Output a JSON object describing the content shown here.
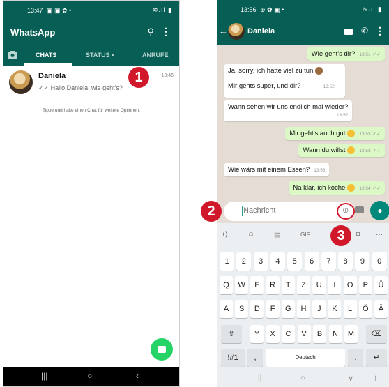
{
  "left_phone": {
    "status_time": "13:47",
    "status_icons": "▣ ▣ ✿ •",
    "status_right": "≋.ıl ▮",
    "app_title": "WhatsApp",
    "tabs": [
      "CHATS",
      "STATUS •",
      "ANRUFE"
    ],
    "chat": {
      "name": "Daniela",
      "preview": "✓✓ Hallo Daniela, wie geht's?",
      "time": "13:46"
    },
    "hint": "Tippe und halte einen Chat für weitere Optionen.",
    "nav": [
      "|||",
      "○",
      "‹"
    ]
  },
  "right_phone": {
    "status_time": "13:56",
    "status_icons": "⊕ ✿ ▣ •",
    "status_right": "≋.ıl ▮",
    "contact_name": "Daniela",
    "messages": [
      {
        "dir": "out",
        "text": "Wie geht's dir?",
        "time": "13:51",
        "check": "✓✓"
      },
      {
        "dir": "in",
        "text": "Ja, sorry, ich hatte viel zu tun",
        "time": ""
      },
      {
        "dir": "in",
        "text": "Mir gehts super, und dir?",
        "time": "13:52"
      },
      {
        "dir": "in",
        "text": "Wann sehen wir uns endlich mal wieder?",
        "time": "13:52"
      },
      {
        "dir": "out",
        "text": "Mir geht's auch gut",
        "time": "13:53",
        "check": "✓✓"
      },
      {
        "dir": "out",
        "text": "Wann du willst",
        "time": "13:53",
        "check": "✓✓"
      },
      {
        "dir": "in",
        "text": "Wie wärs mit einem Essen?",
        "time": "13:53"
      },
      {
        "dir": "out",
        "text": "Na klar, ich koche",
        "time": "13:54",
        "check": "✓✓"
      }
    ],
    "input_placeholder": "Nachricht",
    "keyboard": {
      "strip": [
        "⟨⟩",
        "☺",
        "▤",
        "GIF",
        "⚙",
        "···"
      ],
      "row_numbers": [
        "1",
        "2",
        "3",
        "4",
        "5",
        "6",
        "7",
        "8",
        "9",
        "0"
      ],
      "row1": [
        "Q",
        "W",
        "E",
        "R",
        "T",
        "Z",
        "U",
        "I",
        "O",
        "P",
        "Ü"
      ],
      "row2": [
        "A",
        "S",
        "D",
        "F",
        "G",
        "H",
        "J",
        "K",
        "L",
        "Ö",
        "Ä"
      ],
      "row3": [
        "Y",
        "X",
        "C",
        "V",
        "B",
        "N",
        "M"
      ],
      "bottom": {
        "sym": "!#1",
        "comma": ",",
        "space": "Deutsch",
        "period": ".",
        "enter": "↵",
        "shift": "⇧",
        "backspace": "⌫"
      }
    },
    "nav": [
      "|||",
      "○",
      "∨",
      "⁝"
    ]
  },
  "badges": [
    "1",
    "2",
    "3"
  ],
  "colors": {
    "teal_dark": "#075e54",
    "green": "#25d366",
    "outgoing_bubble": "#dcf8c6",
    "chat_bg": "#e5ddd5",
    "badge_red": "#d0182a"
  }
}
